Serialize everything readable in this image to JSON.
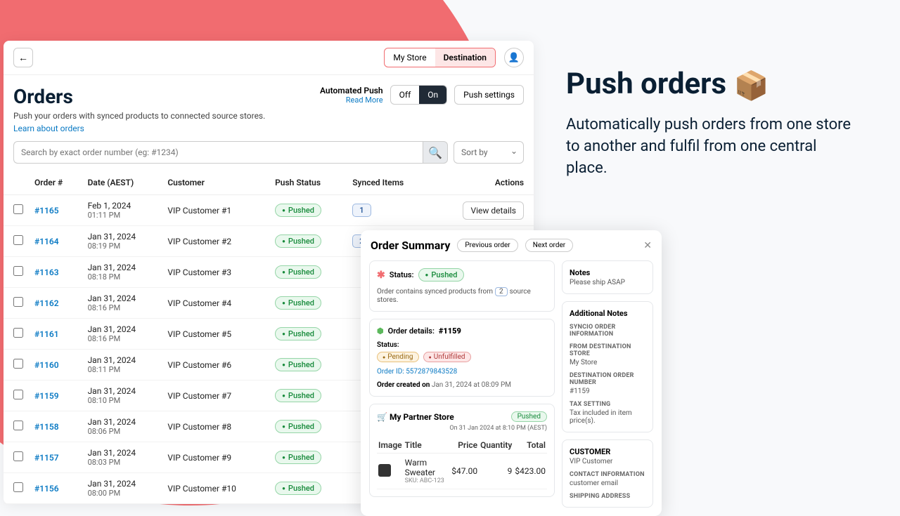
{
  "marketing": {
    "title": "Push orders",
    "desc": "Automatically push orders from one store to another and fulfil from one central place."
  },
  "topbar": {
    "tab_my_store": "My Store",
    "tab_destination": "Destination"
  },
  "page": {
    "title": "Orders",
    "subtitle": "Push your orders with synced products to connected source stores.",
    "learn": "Learn about orders"
  },
  "automated": {
    "title": "Automated Push",
    "read_more": "Read More",
    "off": "Off",
    "on": "On",
    "push_settings": "Push settings"
  },
  "filters": {
    "search_placeholder": "Search by exact order number (eg: #1234)",
    "sort_label": "Sort by"
  },
  "columns": {
    "order": "Order #",
    "date": "Date (AEST)",
    "customer": "Customer",
    "status": "Push Status",
    "synced": "Synced Items",
    "actions": "Actions"
  },
  "status_labels": {
    "pushed": "Pushed",
    "pending": "Pending",
    "unfulfilled": "Unfulfilled"
  },
  "view_details": "View details",
  "orders": {
    "0": {
      "id": "#1165",
      "date": "Feb 1, 2024",
      "time": "01:11 PM",
      "customer": "VIP Customer #1",
      "synced": "1"
    },
    "1": {
      "id": "#1164",
      "date": "Jan 31, 2024",
      "time": "08:19 PM",
      "customer": "VIP Customer #2",
      "synced": "2"
    },
    "2": {
      "id": "#1163",
      "date": "Jan 31, 2024",
      "time": "08:18 PM",
      "customer": "VIP Customer #3"
    },
    "3": {
      "id": "#1162",
      "date": "Jan 31, 2024",
      "time": "08:16 PM",
      "customer": "VIP Customer #4"
    },
    "4": {
      "id": "#1161",
      "date": "Jan 31, 2024",
      "time": "08:16 PM",
      "customer": "VIP Customer #5"
    },
    "5": {
      "id": "#1160",
      "date": "Jan 31, 2024",
      "time": "08:11 PM",
      "customer": "VIP Customer #6"
    },
    "6": {
      "id": "#1159",
      "date": "Jan 31, 2024",
      "time": "08:10 PM",
      "customer": "VIP Customer #7"
    },
    "7": {
      "id": "#1158",
      "date": "Jan 31, 2024",
      "time": "08:06 PM",
      "customer": "VIP Customer #8"
    },
    "8": {
      "id": "#1157",
      "date": "Jan 31, 2024",
      "time": "08:03 PM",
      "customer": "VIP Customer #9"
    },
    "9": {
      "id": "#1156",
      "date": "Jan 31, 2024",
      "time": "08:00 PM",
      "customer": "VIP Customer #10"
    }
  },
  "summary": {
    "title": "Order Summary",
    "prev": "Previous order",
    "next": "Next order",
    "status_label": "Status:",
    "contains_pre": "Order contains synced products from",
    "contains_count": "2",
    "contains_post": "source stores.",
    "details_label": "Order details:",
    "details_id": "#1159",
    "order_id_label": "Order ID:",
    "order_id": "5572879843528",
    "created_label": "Order created on",
    "created_val": "Jan 31, 2024 at 08:09 PM",
    "partner_name": "My Partner Store",
    "partner_pushed": "Pushed",
    "partner_date": "On 31 Jan 2024 at 8:10 PM (AEST)",
    "item_cols": {
      "image": "Image",
      "title": "Title",
      "price": "Price",
      "qty": "Quantity",
      "total": "Total"
    },
    "item": {
      "title": "Warm Sweater",
      "sku": "SKU: ABC-123",
      "price": "$47.00",
      "qty": "9",
      "total": "$423.00"
    },
    "notes_h": "Notes",
    "notes_txt": "Please ship ASAP",
    "addl_h": "Additional Notes",
    "syncio_h": "SYNCIO ORDER INFORMATION",
    "from_lbl": "From destination store",
    "from_val": "My Store",
    "dest_lbl": "Destination order number",
    "dest_val": "#1159",
    "tax_lbl": "Tax setting",
    "tax_val": "Tax included in item price(s).",
    "cust_h": "CUSTOMER",
    "cust_val": "VIP Customer",
    "contact_h": "CONTACT INFORMATION",
    "contact_val": "customer email",
    "ship_h": "SHIPPING ADDRESS"
  }
}
